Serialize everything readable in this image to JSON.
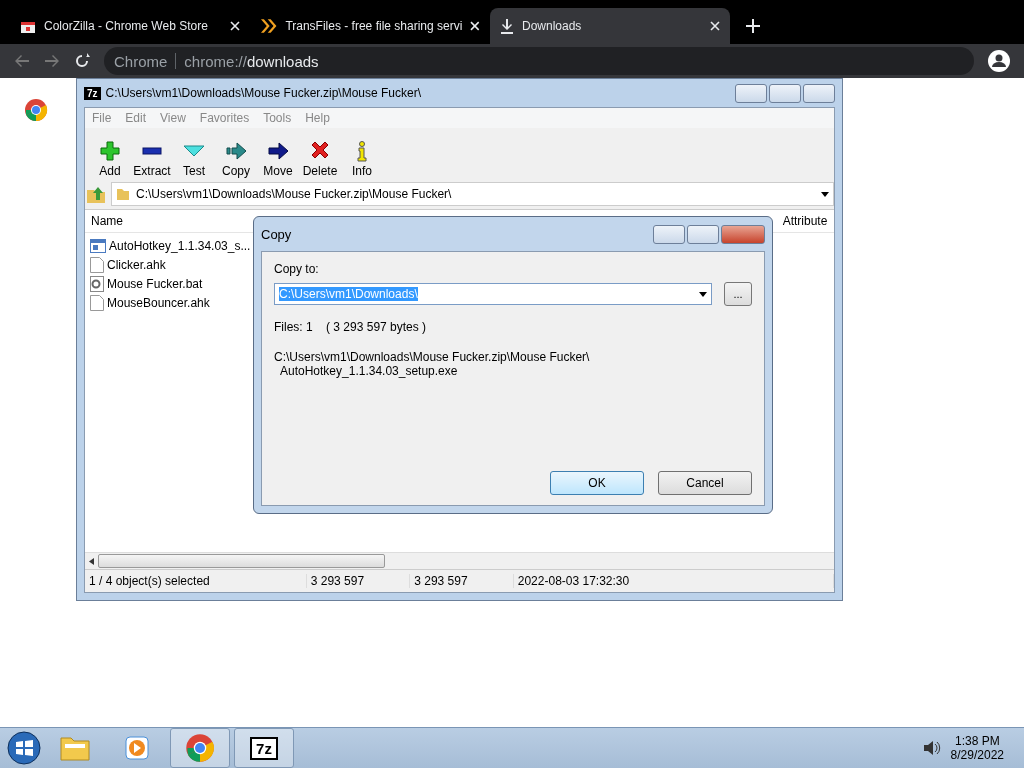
{
  "browser": {
    "tabs": [
      {
        "title": "ColorZilla - Chrome Web Store",
        "kind": "store",
        "selected": false
      },
      {
        "title": "TransFiles - free file sharing servi",
        "kind": "transfer",
        "selected": false
      },
      {
        "title": "Downloads",
        "kind": "download",
        "selected": true
      }
    ],
    "omnibox": {
      "site": "Chrome",
      "url_scheme": "chrome://",
      "url_path": "downloads"
    }
  },
  "archive_window": {
    "app_badge": "7z",
    "title": "C:\\Users\\vm1\\Downloads\\Mouse Fucker.zip\\Mouse Fucker\\",
    "menu": [
      "File",
      "Edit",
      "View",
      "Favorites",
      "Tools",
      "Help"
    ],
    "toolbar": [
      {
        "label": "Add",
        "kind": "add"
      },
      {
        "label": "Extract",
        "kind": "extract"
      },
      {
        "label": "Test",
        "kind": "test"
      },
      {
        "label": "Copy",
        "kind": "copy"
      },
      {
        "label": "Move",
        "kind": "move"
      },
      {
        "label": "Delete",
        "kind": "delete"
      },
      {
        "label": "Info",
        "kind": "info"
      }
    ],
    "path": "C:\\Users\\vm1\\Downloads\\Mouse Fucker.zip\\Mouse Fucker\\",
    "columns": [
      "Name",
      "Attribute"
    ],
    "files": [
      {
        "name": "AutoHotkey_1.1.34.03_s...",
        "kind": "exe"
      },
      {
        "name": "Clicker.ahk",
        "kind": "file"
      },
      {
        "name": "Mouse Fucker.bat",
        "kind": "bat"
      },
      {
        "name": "MouseBouncer.ahk",
        "kind": "file"
      }
    ],
    "status": [
      "1 / 4 object(s) selected",
      "3 293 597",
      "3 293 597",
      "2022-08-03 17:32:30"
    ]
  },
  "dialog": {
    "title": "Copy",
    "label": "Copy to:",
    "value": "C:\\Users\\vm1\\Downloads\\",
    "value_selected": true,
    "browse": "...",
    "files_line": "Files: 1    ( 3 293 597 bytes )",
    "source": [
      "C:\\Users\\vm1\\Downloads\\Mouse Fucker.zip\\Mouse Fucker\\",
      "AutoHotkey_1.1.34.03_setup.exe"
    ],
    "buttons": [
      {
        "label": "OK",
        "selected": true
      },
      {
        "label": "Cancel",
        "selected": false
      }
    ]
  },
  "taskbar": {
    "apps": [
      {
        "kind": "explorer"
      },
      {
        "kind": "media"
      },
      {
        "kind": "chrome"
      },
      {
        "kind": "sevenzip",
        "badge": "7z"
      }
    ],
    "time": "1:38 PM",
    "date": "8/29/2022"
  }
}
